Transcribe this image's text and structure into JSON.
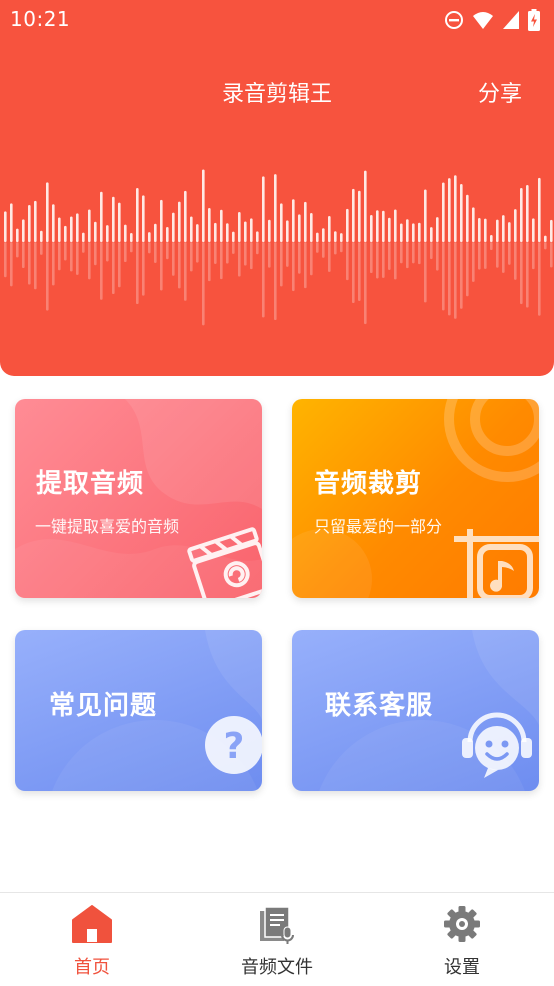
{
  "status_bar": {
    "time": "10:21"
  },
  "header": {
    "title": "录音剪辑王",
    "share_label": "分享"
  },
  "cards": {
    "extract": {
      "title": "提取音频",
      "subtitle": "一键提取喜爱的音频"
    },
    "trim": {
      "title": "音频裁剪",
      "subtitle": "只留最爱的一部分"
    },
    "faq": {
      "title": "常见问题"
    },
    "service": {
      "title": "联系客服"
    }
  },
  "tabs": [
    {
      "label": "首页",
      "icon": "home-icon",
      "active": true
    },
    {
      "label": "音频文件",
      "icon": "audio-file-icon",
      "active": false
    },
    {
      "label": "设置",
      "icon": "gear-icon",
      "active": false
    }
  ],
  "colors": {
    "accent": "#f7533e",
    "tab_active": "#f0523d",
    "card_extract": "#f9636c",
    "card_trim": "#ff8a00",
    "card_blue": "#7b98f3"
  }
}
